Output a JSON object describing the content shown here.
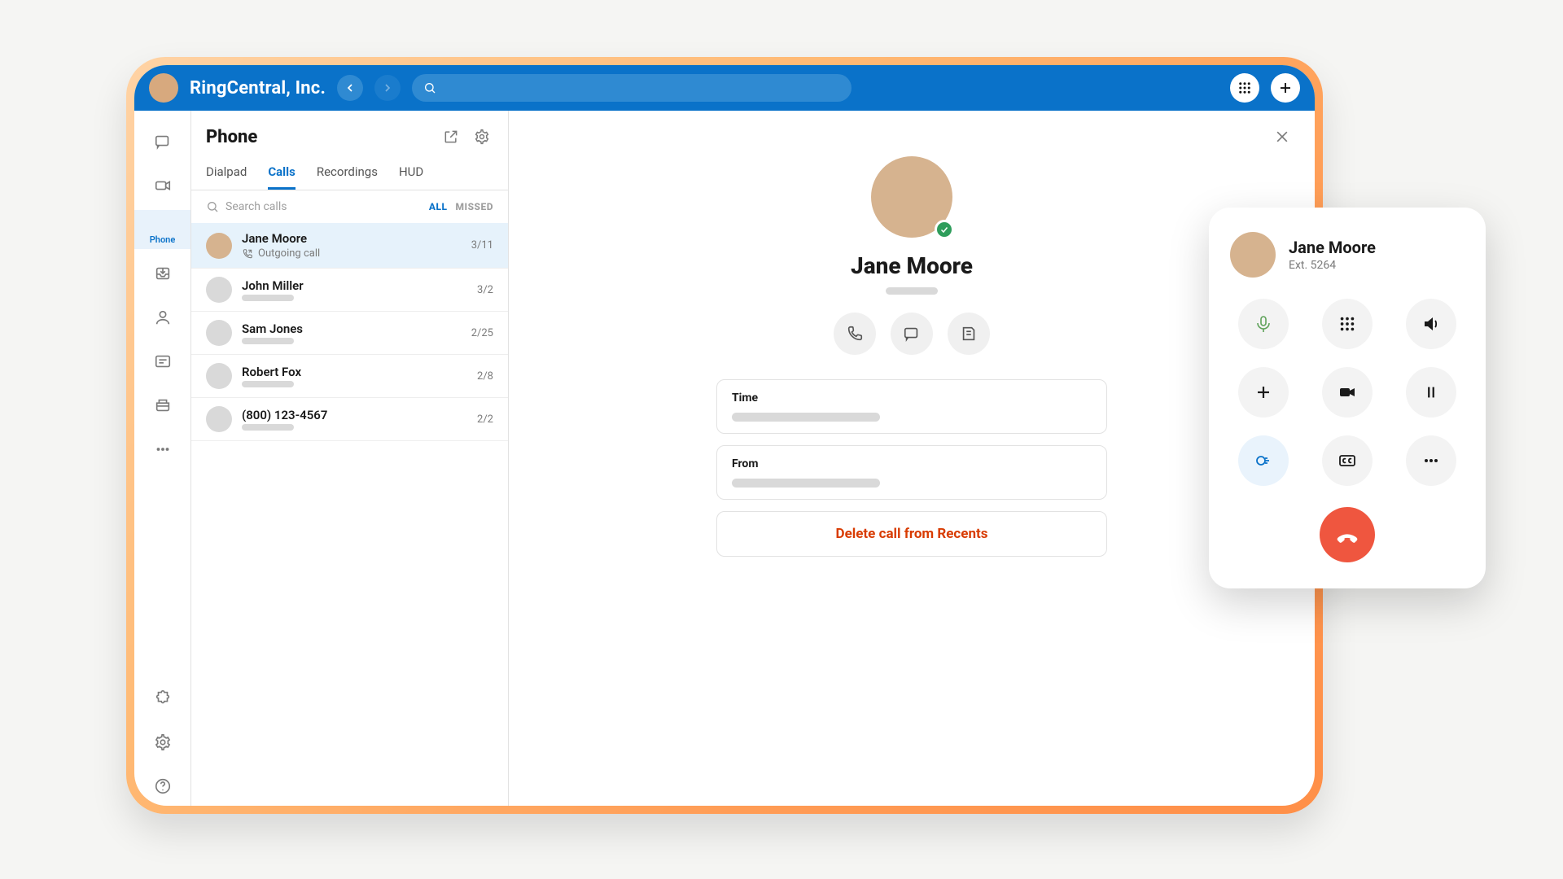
{
  "header": {
    "brand": "RingCentral, Inc.",
    "search_placeholder": ""
  },
  "rail": {
    "phone_label": "Phone"
  },
  "panel": {
    "title": "Phone",
    "tabs": [
      "Dialpad",
      "Calls",
      "Recordings",
      "HUD"
    ],
    "active_tab": "Calls",
    "search_placeholder": "Search calls",
    "filters": {
      "all": "ALL",
      "missed": "MISSED",
      "active": "ALL"
    },
    "calls": [
      {
        "name": "Jane Moore",
        "subtitle": "Outgoing call",
        "date": "3/11",
        "selected": true,
        "has_avatar": true
      },
      {
        "name": "John Miller",
        "subtitle": "",
        "date": "3/2",
        "selected": false,
        "has_avatar": false
      },
      {
        "name": "Sam Jones",
        "subtitle": "",
        "date": "2/25",
        "selected": false,
        "has_avatar": false
      },
      {
        "name": "Robert Fox",
        "subtitle": "",
        "date": "2/8",
        "selected": false,
        "has_avatar": false
      },
      {
        "name": "(800) 123-4567",
        "subtitle": "",
        "date": "2/2",
        "selected": false,
        "has_avatar": false
      }
    ]
  },
  "detail": {
    "name": "Jane Moore",
    "time_label": "Time",
    "from_label": "From",
    "delete_label": "Delete call from Recents"
  },
  "call_card": {
    "name": "Jane Moore",
    "ext": "Ext. 5264"
  }
}
